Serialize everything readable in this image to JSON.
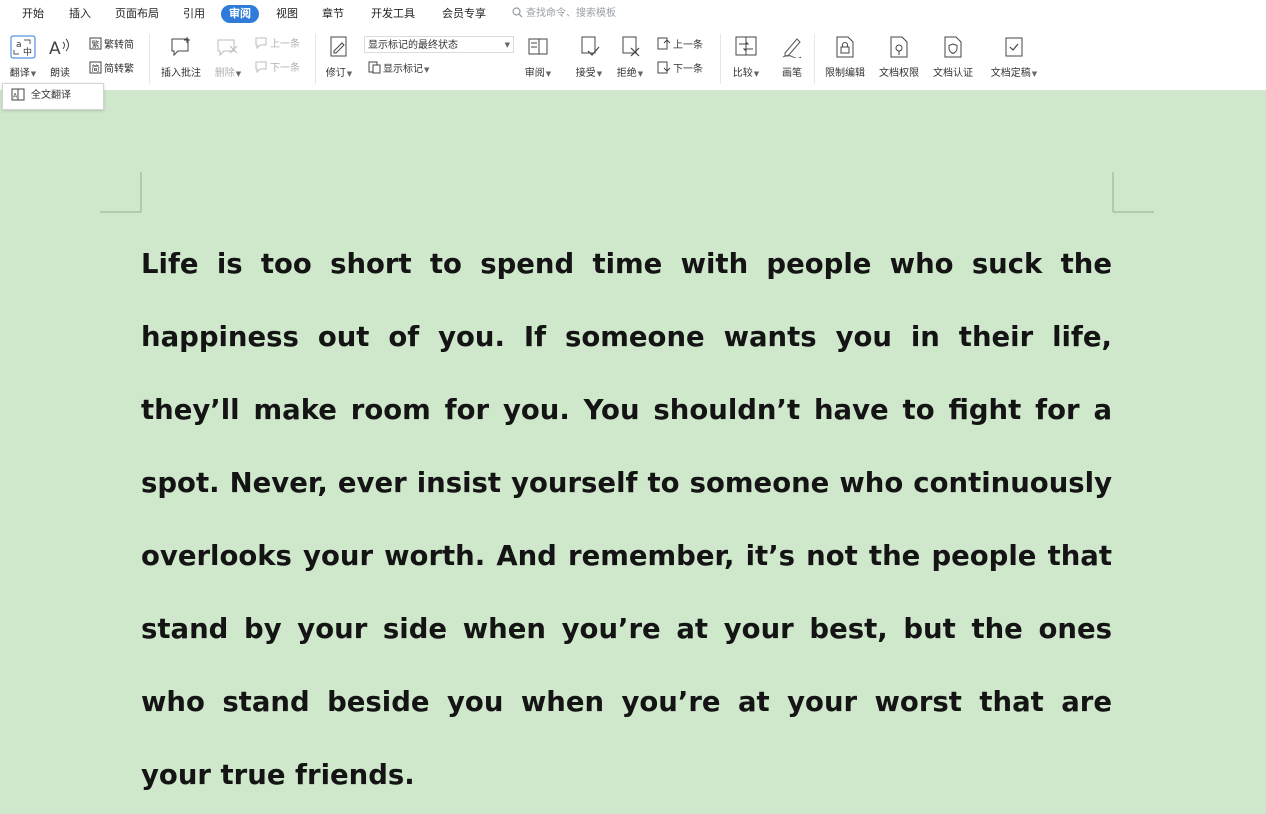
{
  "menu": {
    "tabs": [
      "开始",
      "插入",
      "页面布局",
      "引用",
      "审阅",
      "视图",
      "章节",
      "开发工具",
      "会员专享"
    ],
    "active_tab": "审阅",
    "search_placeholder": "查找命令、搜索模板"
  },
  "ribbon": {
    "translate": "翻译",
    "read_aloud": "朗读",
    "trad_to_simp": "繁转简",
    "simp_to_trad": "简转繁",
    "insert_comment": "插入批注",
    "delete": "删除",
    "prev_comment": "上一条",
    "next_comment": "下一条",
    "track_changes": "修订",
    "markup_mode": "显示标记的最终状态",
    "show_markup": "显示标记",
    "review": "审阅",
    "accept": "接受",
    "reject": "拒绝",
    "prev_change": "上一条",
    "next_change": "下一条",
    "compare": "比较",
    "pen": "画笔",
    "restrict_editing": "限制编辑",
    "document_permissions": "文档权限",
    "document_certification": "文档认证",
    "document_finalize": "文档定稿"
  },
  "popup": {
    "full_translate": "全文翻译"
  },
  "document": {
    "text": "Life is too short to spend time with people who suck the happiness out of you. If someone wants you in their life, they’ll make room for you. You shouldn’t have to fight for a spot. Never, ever insist yourself to someone who continuously overlooks your worth. And remember, it’s not the people that stand by your side when you’re at your best, but the ones who stand beside you when you’re at your worst that are your true friends."
  },
  "colors": {
    "accent": "#2e7bd9",
    "page_background": "#cfe8cc",
    "text": "#141414"
  },
  "icons": [
    "search-icon",
    "translate-icon",
    "read-aloud-icon",
    "trad-simp-icon",
    "simp-trad-icon",
    "comment-add-icon",
    "comment-delete-icon",
    "prev-icon",
    "next-icon",
    "track-changes-icon",
    "show-markup-icon",
    "review-pane-icon",
    "accept-icon",
    "reject-icon",
    "compare-icon",
    "pen-icon",
    "lock-icon",
    "permission-icon",
    "certify-icon",
    "finalize-icon",
    "full-translate-icon"
  ]
}
